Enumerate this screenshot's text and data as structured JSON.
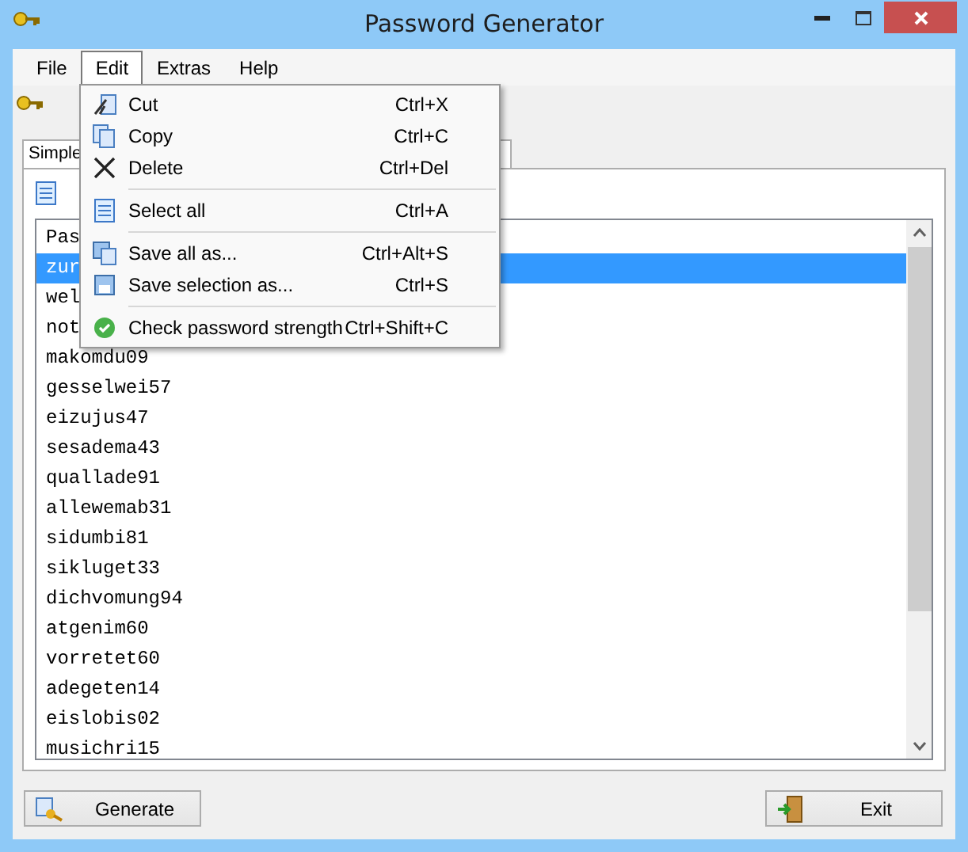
{
  "window": {
    "title": "Password Generator"
  },
  "menubar": [
    {
      "label": "File",
      "selected": false
    },
    {
      "label": "Edit",
      "selected": true
    },
    {
      "label": "Extras",
      "selected": false
    },
    {
      "label": "Help",
      "selected": false
    }
  ],
  "tabs": [
    {
      "label": "Simple",
      "selected": true
    }
  ],
  "edit_menu": [
    {
      "kind": "item",
      "label": "Cut",
      "shortcut": "Ctrl+X"
    },
    {
      "kind": "item",
      "label": "Copy",
      "shortcut": "Ctrl+C"
    },
    {
      "kind": "item",
      "label": "Delete",
      "shortcut": "Ctrl+Del"
    },
    {
      "kind": "separator"
    },
    {
      "kind": "item",
      "label": "Select all",
      "shortcut": "Ctrl+A"
    },
    {
      "kind": "separator"
    },
    {
      "kind": "item",
      "label": "Save all as...",
      "shortcut": "Ctrl+Alt+S"
    },
    {
      "kind": "item",
      "label": "Save selection as...",
      "shortcut": "Ctrl+S"
    },
    {
      "kind": "separator"
    },
    {
      "kind": "item",
      "label": "Check password strength",
      "shortcut": "Ctrl+Shift+C"
    }
  ],
  "list": {
    "rows": [
      {
        "text": "Pas",
        "selected": false
      },
      {
        "text": "zur",
        "selected": true
      },
      {
        "text": "wel",
        "selected": false
      },
      {
        "text": "not",
        "selected": false
      },
      {
        "text": "makomdu09",
        "selected": false
      },
      {
        "text": "gesselwei57",
        "selected": false
      },
      {
        "text": "eizujus47",
        "selected": false
      },
      {
        "text": "sesadema43",
        "selected": false
      },
      {
        "text": "quallade91",
        "selected": false
      },
      {
        "text": "allewemab31",
        "selected": false
      },
      {
        "text": "sidumbi81",
        "selected": false
      },
      {
        "text": "sikluget33",
        "selected": false
      },
      {
        "text": "dichvomung94",
        "selected": false
      },
      {
        "text": "atgenim60",
        "selected": false
      },
      {
        "text": "vorretet60",
        "selected": false
      },
      {
        "text": "adegeten14",
        "selected": false
      },
      {
        "text": "eislobis02",
        "selected": false
      },
      {
        "text": "musichri15",
        "selected": false
      }
    ]
  },
  "buttons": [
    {
      "kind": "generate",
      "label": "Generate"
    },
    {
      "kind": "exit",
      "label": "Exit"
    }
  ]
}
